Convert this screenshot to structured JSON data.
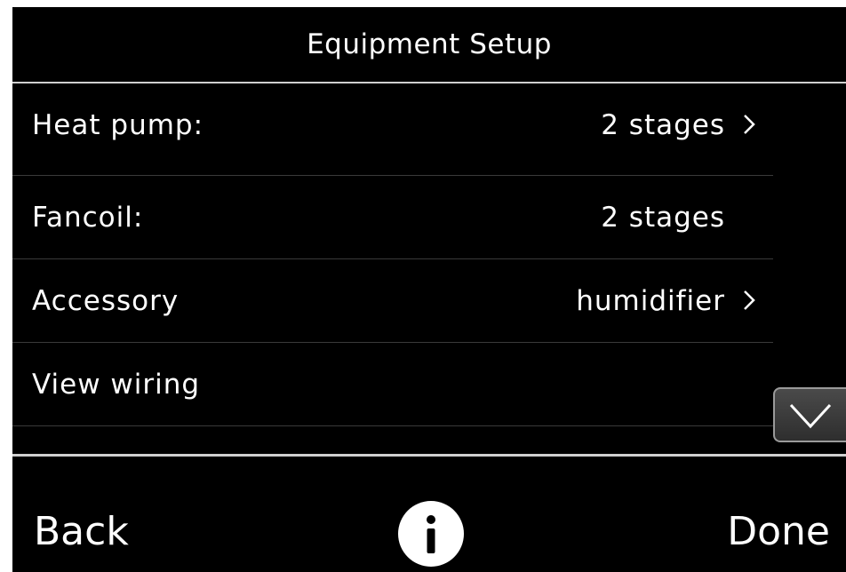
{
  "header": {
    "title": "Equipment Setup"
  },
  "rows": [
    {
      "label": "Heat pump:",
      "value": "2 stages",
      "has_chevron": true
    },
    {
      "label": "Fancoil:",
      "value": "2 stages",
      "has_chevron": false
    },
    {
      "label": "Accessory",
      "value": "humidifier",
      "has_chevron": true
    },
    {
      "label": "View wiring",
      "value": "",
      "has_chevron": false
    }
  ],
  "footer": {
    "back_label": "Back",
    "done_label": "Done",
    "info_icon": "info-icon"
  },
  "scroll": {
    "icon": "chevron-down-icon"
  },
  "colors": {
    "background": "#000000",
    "text": "#ffffff",
    "divider": "#cfcfcf"
  }
}
